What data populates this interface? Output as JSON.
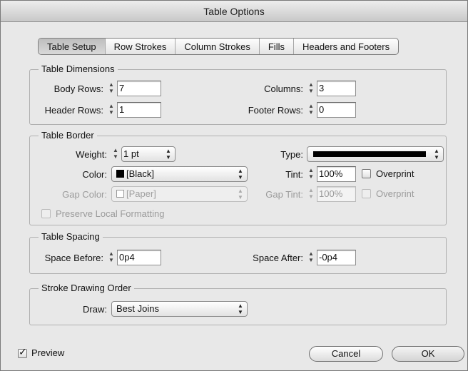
{
  "window": {
    "title": "Table Options"
  },
  "tabs": [
    {
      "label": "Table Setup",
      "active": true
    },
    {
      "label": "Row Strokes"
    },
    {
      "label": "Column Strokes"
    },
    {
      "label": "Fills"
    },
    {
      "label": "Headers and Footers"
    }
  ],
  "table_dimensions": {
    "legend": "Table Dimensions",
    "body_rows_label": "Body Rows:",
    "body_rows": "7",
    "columns_label": "Columns:",
    "columns": "3",
    "header_rows_label": "Header Rows:",
    "header_rows": "1",
    "footer_rows_label": "Footer Rows:",
    "footer_rows": "0"
  },
  "table_border": {
    "legend": "Table Border",
    "weight_label": "Weight:",
    "weight": "1 pt",
    "type_label": "Type:",
    "color_label": "Color:",
    "color": "[Black]",
    "color_swatch": "#000000",
    "tint_label": "Tint:",
    "tint": "100%",
    "overprint_label": "Overprint",
    "gap_color_label": "Gap Color:",
    "gap_color": "[Paper]",
    "gap_swatch": "#ffffff",
    "gap_tint_label": "Gap Tint:",
    "gap_tint": "100%",
    "gap_overprint_label": "Overprint",
    "preserve_label": "Preserve Local Formatting"
  },
  "table_spacing": {
    "legend": "Table Spacing",
    "space_before_label": "Space Before:",
    "space_before": "0p4",
    "space_after_label": "Space After:",
    "space_after": "-0p4"
  },
  "stroke_order": {
    "legend": "Stroke Drawing Order",
    "draw_label": "Draw:",
    "draw": "Best Joins"
  },
  "footer": {
    "preview_label": "Preview",
    "preview_checked": true,
    "cancel_label": "Cancel",
    "ok_label": "OK"
  }
}
